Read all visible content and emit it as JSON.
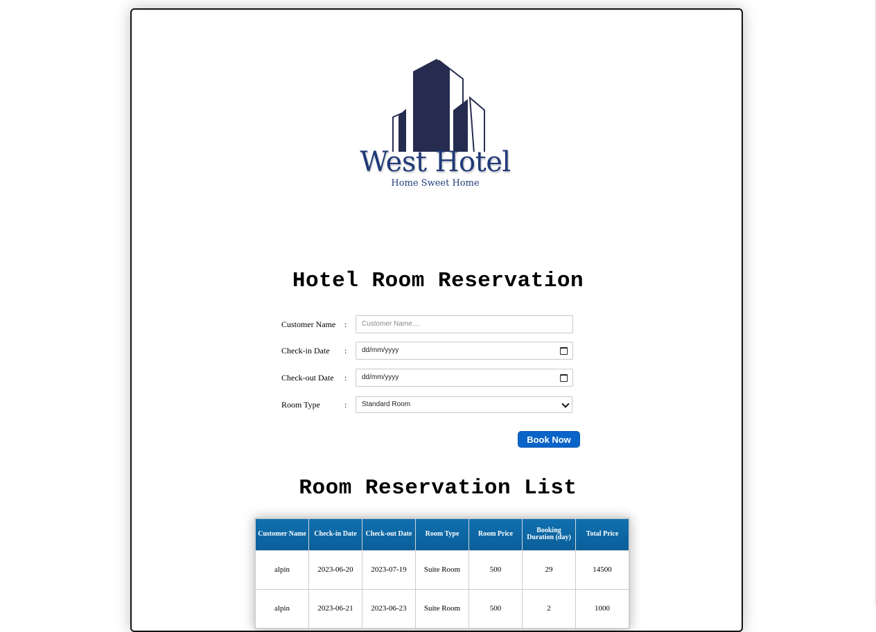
{
  "brand": {
    "name": "West Hotel",
    "tagline": "Home Sweet Home",
    "colors": {
      "dark": "#262c50",
      "accent": "#1f3a78"
    }
  },
  "reservation_form": {
    "title": "Hotel Room Reservation",
    "separator": ":",
    "customer_name": {
      "label": "Customer Name",
      "placeholder": "Customer Name...."
    },
    "check_in": {
      "label": "Check-in Date",
      "placeholder": "dd/mm/yyyy",
      "icon": "calendar-icon"
    },
    "check_out": {
      "label": "Check-out Date",
      "placeholder": "dd/mm/yyyy",
      "icon": "calendar-icon"
    },
    "room_type": {
      "label": "Room Type",
      "selected": "Standard Room",
      "icon": "chevron-down-icon"
    },
    "submit_label": "Book Now",
    "button_color": "#0a64c8"
  },
  "reservation_list": {
    "title": "Room Reservation List",
    "header_color": "#0f6fae",
    "columns": [
      "Customer Name",
      "Check-in Date",
      "Check-out Date",
      "Room Type",
      "Room Price",
      "Booking Duration (day)",
      "Total Price"
    ],
    "rows": [
      [
        "alpin",
        "2023-06-20",
        "2023-07-19",
        "Suite Room",
        "500",
        "29",
        "14500"
      ],
      [
        "alpin",
        "2023-06-21",
        "2023-06-23",
        "Suite Room",
        "500",
        "2",
        "1000"
      ]
    ]
  }
}
